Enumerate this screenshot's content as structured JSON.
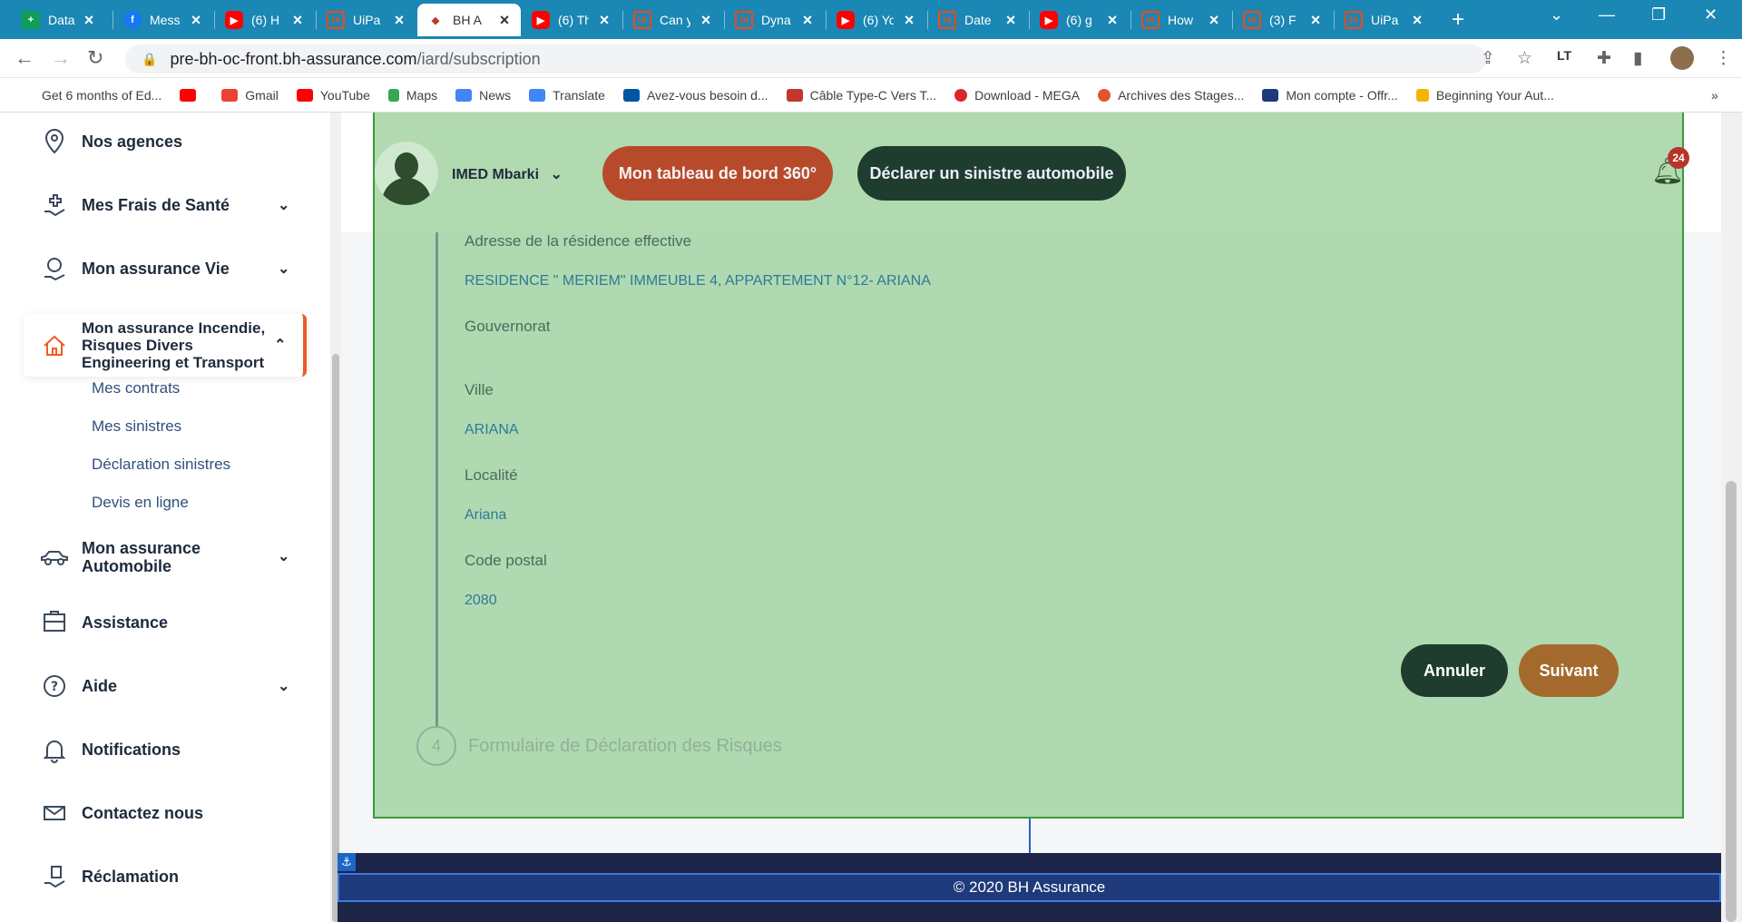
{
  "browser": {
    "tabs": [
      {
        "title": "Data",
        "favicon": "sheets-icon"
      },
      {
        "title": "Mess",
        "favicon": "facebook-icon"
      },
      {
        "title": "(6) H",
        "favicon": "youtube-icon"
      },
      {
        "title": "UiPa",
        "favicon": "uipath-icon"
      },
      {
        "title": "BH A",
        "favicon": "bh-icon",
        "active": true
      },
      {
        "title": "(6) Th",
        "favicon": "youtube-icon"
      },
      {
        "title": "Can y",
        "favicon": "uipath-icon"
      },
      {
        "title": "Dyna",
        "favicon": "uipath-icon"
      },
      {
        "title": "(6) Yo",
        "favicon": "youtube-icon"
      },
      {
        "title": "Date",
        "favicon": "uipath-icon"
      },
      {
        "title": "(6) g",
        "favicon": "youtube-icon"
      },
      {
        "title": "How",
        "favicon": "uipath-icon"
      },
      {
        "title": "(3) F",
        "favicon": "uipath-icon"
      },
      {
        "title": "UiPa",
        "favicon": "uipath-icon"
      }
    ],
    "url_host": "pre-bh-oc-front.bh-assurance.com",
    "url_path": "/iard/subscription",
    "bookmarks": [
      {
        "label": "Get 6 months of Ed...",
        "color": "#ffffff"
      },
      {
        "label": "",
        "color": "#ff0000"
      },
      {
        "label": "Gmail",
        "color": "#ea4335"
      },
      {
        "label": "YouTube",
        "color": "#ff0000"
      },
      {
        "label": "Maps",
        "color": "#34a853"
      },
      {
        "label": "News",
        "color": "#4285f4"
      },
      {
        "label": "Translate",
        "color": "#4285f4"
      },
      {
        "label": "Avez-vous besoin d...",
        "color": "#0055a4"
      },
      {
        "label": "Câble Type-C Vers T...",
        "color": "#c0392b"
      },
      {
        "label": "Download - MEGA",
        "color": "#d9272e"
      },
      {
        "label": "Archives des Stages...",
        "color": "#e2542c"
      },
      {
        "label": "Mon compte - Offr...",
        "color": "#1e3a7a"
      },
      {
        "label": "Beginning Your Aut...",
        "color": "#f4b400"
      }
    ],
    "bookmarks_more": "»"
  },
  "sidebar": {
    "items": [
      {
        "label": "Nos agences",
        "icon": "location-pin-icon"
      },
      {
        "label": "Mes Frais de Santé",
        "icon": "health-hand-icon"
      },
      {
        "label": "Mon assurance Vie",
        "icon": "life-insurance-icon"
      },
      {
        "label": "Mon assurance Incendie, Risques Divers Engineering et Transport",
        "icon": "house-icon"
      },
      {
        "label": "Mon assurance Automobile",
        "icon": "car-icon"
      },
      {
        "label": "Assistance",
        "icon": "assistance-icon"
      },
      {
        "label": "Aide",
        "icon": "help-icon"
      },
      {
        "label": "Notifications",
        "icon": "bell-icon"
      },
      {
        "label": "Contactez nous",
        "icon": "contact-icon"
      },
      {
        "label": "Réclamation",
        "icon": "complaint-icon"
      }
    ],
    "submenu": [
      "Mes contrats",
      "Mes sinistres",
      "Déclaration sinistres",
      "Devis en ligne"
    ]
  },
  "header": {
    "username": "IMED Mbarki",
    "dashboard_btn": "Mon tableau de bord 360°",
    "declare_btn": "Déclarer un sinistre automobile",
    "notif_count": "24"
  },
  "form": {
    "fields": [
      {
        "label": "Adresse de la résidence effective",
        "value": "RESIDENCE \" MERIEM\" IMMEUBLE 4, APPARTEMENT N°12- ARIANA"
      },
      {
        "label": "Gouvernorat",
        "value": ""
      },
      {
        "label": "Ville",
        "value": "ARIANA"
      },
      {
        "label": "Localité",
        "value": "Ariana"
      },
      {
        "label": "Code postal",
        "value": "2080"
      }
    ],
    "cancel_label": "Annuler",
    "next_label": "Suivant",
    "next_step_number": "4",
    "next_step_title": "Formulaire de Déclaration des Risques"
  },
  "footer": {
    "copyright": "© 2020 BH Assurance"
  },
  "colors": {
    "tabstrip": "#1a87b4",
    "accent_orange": "#f15a24",
    "dark_green": "#1e3d2e",
    "overlay_green": "#a0d2a0",
    "footer_navy": "#1c2448"
  }
}
